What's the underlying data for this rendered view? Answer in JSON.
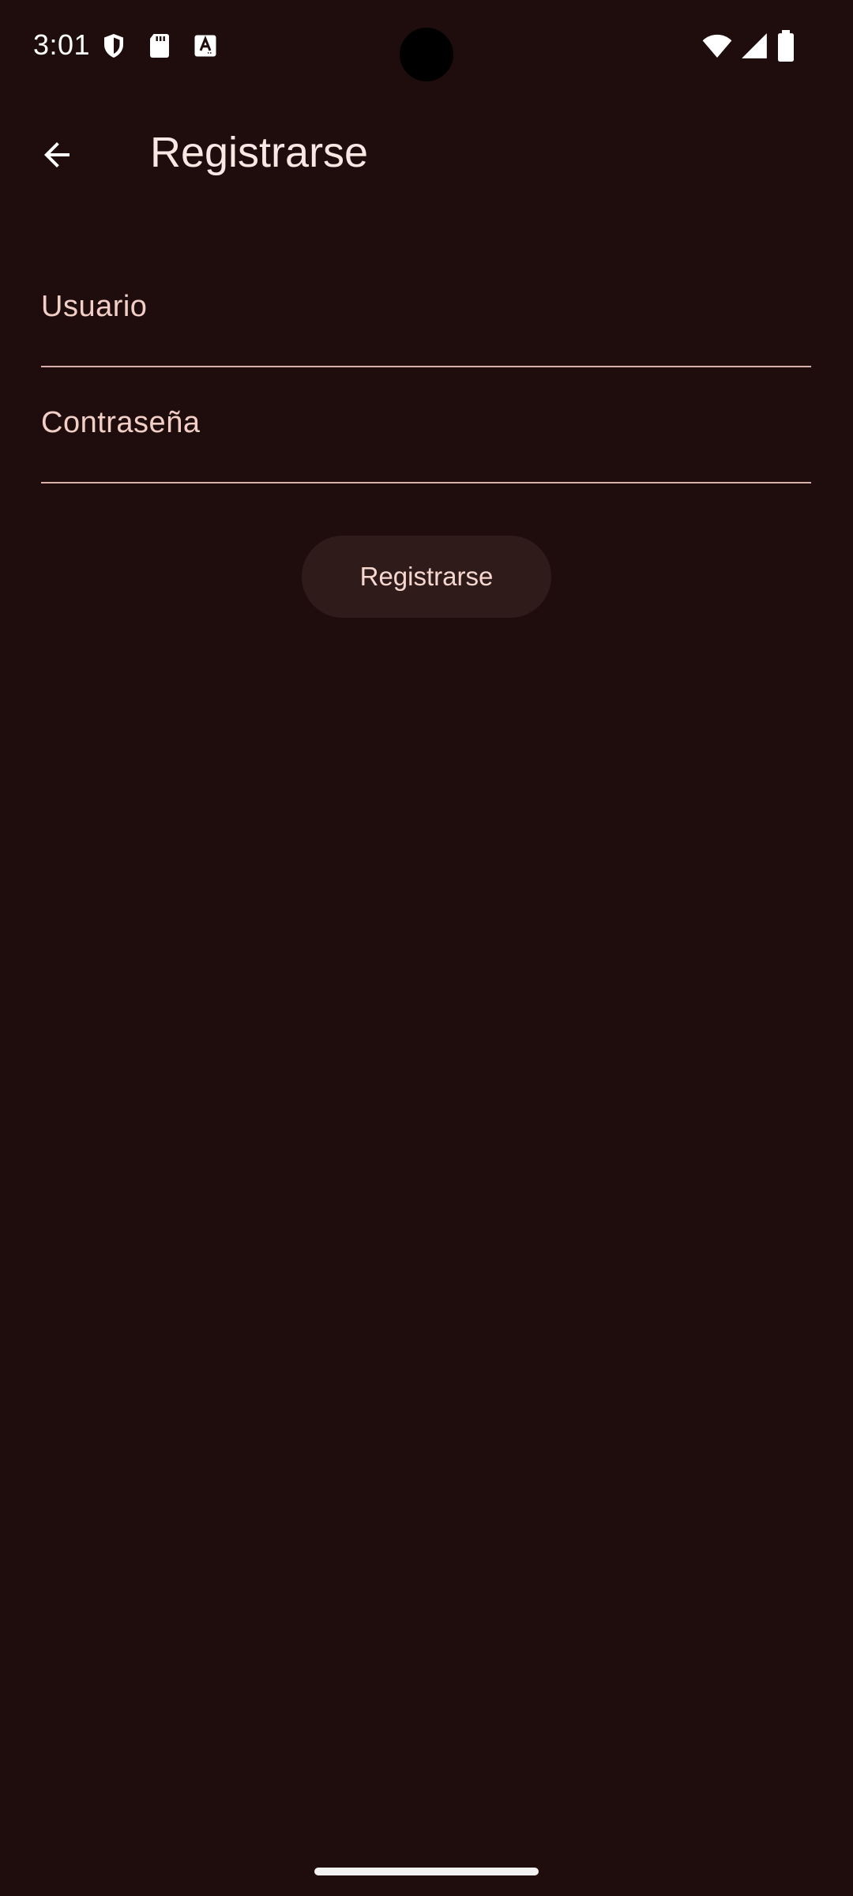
{
  "status_bar": {
    "time": "3:01",
    "left_icons": [
      "shield-icon",
      "sd-card-icon",
      "font-a-icon"
    ],
    "right_icons": [
      "wifi-icon",
      "signal-icon",
      "battery-icon"
    ]
  },
  "app_bar": {
    "back_icon": "arrow-left-icon",
    "title": "Registrarse"
  },
  "form": {
    "username": {
      "label": "Usuario",
      "value": ""
    },
    "password": {
      "label": "Contraseña",
      "value": ""
    },
    "submit_label": "Registrarse"
  },
  "colors": {
    "background": "#1f0d0d",
    "button_bg": "#2f1b1a",
    "label": "#f2cfc6",
    "underline": "#d9b1a8"
  }
}
